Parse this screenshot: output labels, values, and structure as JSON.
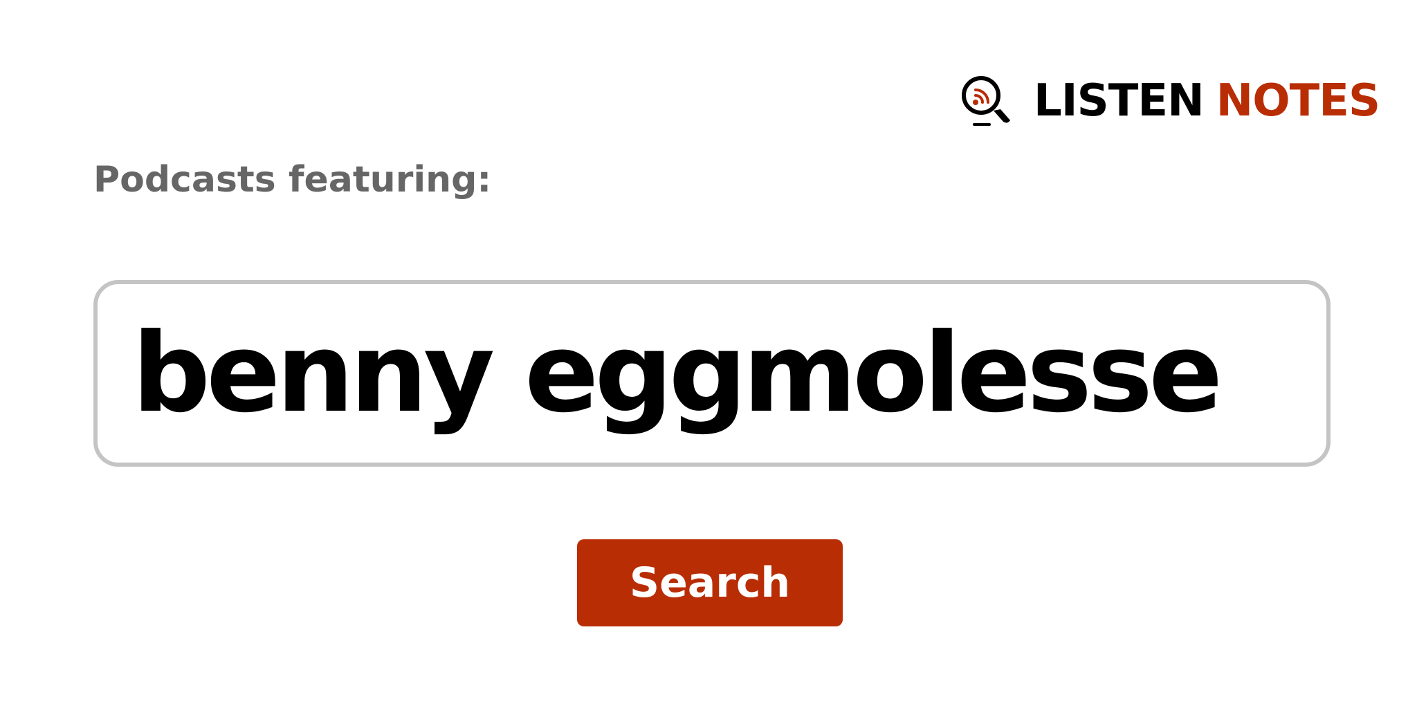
{
  "brand": {
    "icon": "magnifier-podcast-icon",
    "word_primary": "LISTEN",
    "word_accent": "NOTES",
    "colors": {
      "primary": "#000000",
      "accent": "#b92d05"
    }
  },
  "prompt": {
    "label": "Podcasts featuring:"
  },
  "search": {
    "value": "benny eggmolesse",
    "placeholder": ""
  },
  "actions": {
    "search_label": "Search",
    "button_color": "#b92d05"
  }
}
